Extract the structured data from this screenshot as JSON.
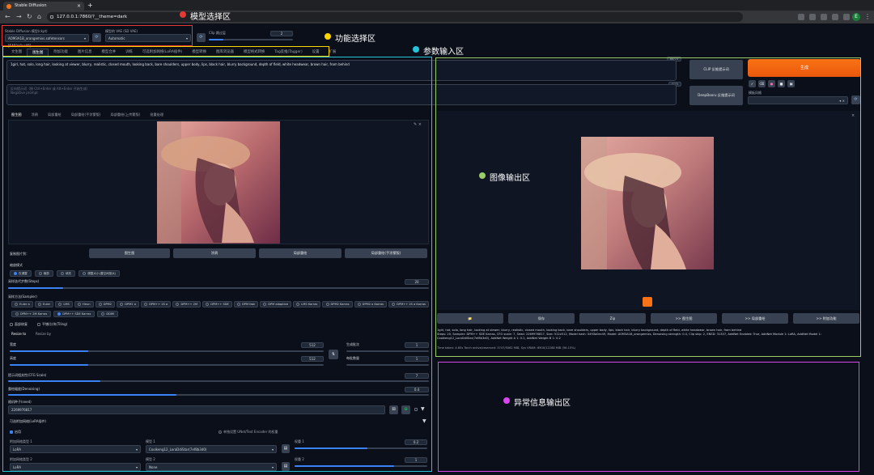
{
  "browser": {
    "tab_title": "Stable Diffusion",
    "tab_close": "×",
    "new_tab": "+",
    "url": "127.0.0.1:7860/?__theme=dark"
  },
  "model": {
    "ckpt_label": "Stable Diffusion 模型(ckpt)",
    "ckpt_value": "AOM3A1B_orangemixs.safetensors [5493a0ec49]",
    "vae_label": "模型的 VAE (SD VAE)",
    "vae_value": "Automatic",
    "clip_label": "Clip 跳过层",
    "clip_value": "2",
    "clip_fraction": 0.17
  },
  "main_tabs": [
    "文生图",
    "图生图",
    "附加功能",
    "图片信息",
    "模型合并",
    "训练",
    "可选附加网络(LoRA插件)",
    "模型转换",
    "图库浏览器",
    "模型格式转换",
    "Tag反推(Tagger)",
    "设置",
    "扩展"
  ],
  "main_tab_active": 1,
  "prompt": {
    "positive": "1girl, hat, solo, long hair, looking at viewer, blurry, realistic, closed mouth, looking back, bare shoulders, upper body, lips, black hair, blurry background, depth of field, white headwear, brown hair, from behind",
    "positive_count": "66/75",
    "negative_placeholder": "反向提示词（按 Ctrl+Enter 或 Alt+Enter 开始生成）",
    "negative_placeholder2": "Negative prompt",
    "negative_count": "0/75"
  },
  "right_buttons": {
    "clip": "CLIP    反推提示词",
    "deepbooru": "DeepBooru 反推提示词",
    "generate": "生成",
    "style_label": "模板风格"
  },
  "img2img_tabs": [
    "图生图",
    "涂鸦",
    "局部重绘",
    "局部重绘(手涂蒙版)",
    "局部重绘(上传蒙版)",
    "批量处理"
  ],
  "copy_to": {
    "label": "复制图片到：",
    "buttons": [
      "图生图",
      "涂鸦",
      "局部重绘",
      "局部重绘(手涂蒙版)"
    ]
  },
  "resize": {
    "label": "缩放模式",
    "options": [
      "仅调整",
      "裁剪",
      "填充",
      "调整大小(潜空间放大)"
    ],
    "selected": 0
  },
  "steps": {
    "label": "采样迭代步数(Steps)",
    "value": "20",
    "fraction": 0.13
  },
  "sampler": {
    "label": "采样方法(Sampler)",
    "row1": [
      "Euler a",
      "Euler",
      "LMS",
      "Heun",
      "DPM2",
      "DPM2 a",
      "DPM++ 2S a",
      "DPM++ 2M",
      "DPM++ SDE",
      "DPM fast",
      "DPM adaptive",
      "LMS Karras",
      "DPM2 Karras",
      "DPM2 a Karras",
      "DPM++ 2S a Karras"
    ],
    "row2": [
      "DPM++ 2M Karras",
      "DPM++ SDE Karras",
      "DDIM"
    ],
    "selected": "DPM++ SDE Karras"
  },
  "options": {
    "restore_faces": "面部修复",
    "tiling": "平铺/分块(Tiling)",
    "resize_to": "Resize to",
    "resize_by": "Resize by"
  },
  "size": {
    "width_label": "宽度",
    "width_value": "512",
    "width_fraction": 0.25,
    "height_label": "高度",
    "height_value": "512",
    "height_fraction": 0.25,
    "swap_icon": "⇅",
    "batch_count_label": "生成批次",
    "batch_count_value": "1",
    "batch_size_label": "每批数量",
    "batch_size_value": "1"
  },
  "cfg": {
    "label": "提示词相关性(CFG Scale)",
    "value": "7",
    "fraction": 0.22
  },
  "denoise": {
    "label": "重绘幅度(Denoising)",
    "value": "0.4",
    "fraction": 0.4
  },
  "seed": {
    "label": "随机种子(seed)",
    "value": "2269976817"
  },
  "lora": {
    "title": "可选附加网络(LoRA插件)",
    "enable": "启用",
    "sep_toggle": "单独设置 UNet/Text Encoder 的权重",
    "model1_type_label": "附加网络类型 1",
    "model1_type": "LoRA",
    "model1_label": "模型 1",
    "model1": "Coolkeng12_LoraDdiStar(7ef8b3d0)",
    "weight1_label": "权重 1",
    "weight1": "0.2",
    "weight1_fraction": 0.55,
    "model2_type_label": "附加网络类型 2",
    "model2_type": "LoRA",
    "model2_label": "模型 2",
    "model2": "None",
    "weight2_label": "权重 2",
    "weight2": "1",
    "weight2_fraction": 0.75
  },
  "output": {
    "buttons": [
      "📁",
      "保存",
      "Zip",
      ">> 图生图",
      ">> 局部重绘",
      ">> 附加功能"
    ],
    "info_line1": "1girl, hat, solo, long hair, looking at viewer, blurry, realistic, closed mouth, looking back, bare shoulders, upper body, lips, black hair, blurry background, depth of field, white headwear, brown hair, from behind",
    "info_line2": "Steps: 20, Sampler: DPM++ SDE Karras, CFG scale: 7, Seed: 2269976817, Size: 512x512, Model hash: 5493a0ec49, Model: AOM3A1B_orangemixs, Denoising strength: 0.4, Clip skip: 2, ENSD: 31337, AddNet Enabled: True, AddNet Module 1: LoRA, AddNet Model 1: Coolkeng12_LoraDdiStar(7ef8b3d0), AddNet Weight A 1: 0.2, AddNet Weight B 1: 0.2",
    "info_line3": "Time taken: 4.65s  Torch active/reserved: 3747/5062 MiB, Sys VRAM: 6900/12288 MiB (56.15%)"
  },
  "annotations": {
    "model_area": "模型选择区",
    "function_area": "功能选择区",
    "param_area": "参数输入区",
    "output_area": "图像输出区",
    "error_area": "异常信息输出区",
    "colors": {
      "model": "#e53935",
      "function": "#ffd600",
      "param": "#26c6da",
      "output": "#9ccc65",
      "error": "#d946ef"
    }
  }
}
